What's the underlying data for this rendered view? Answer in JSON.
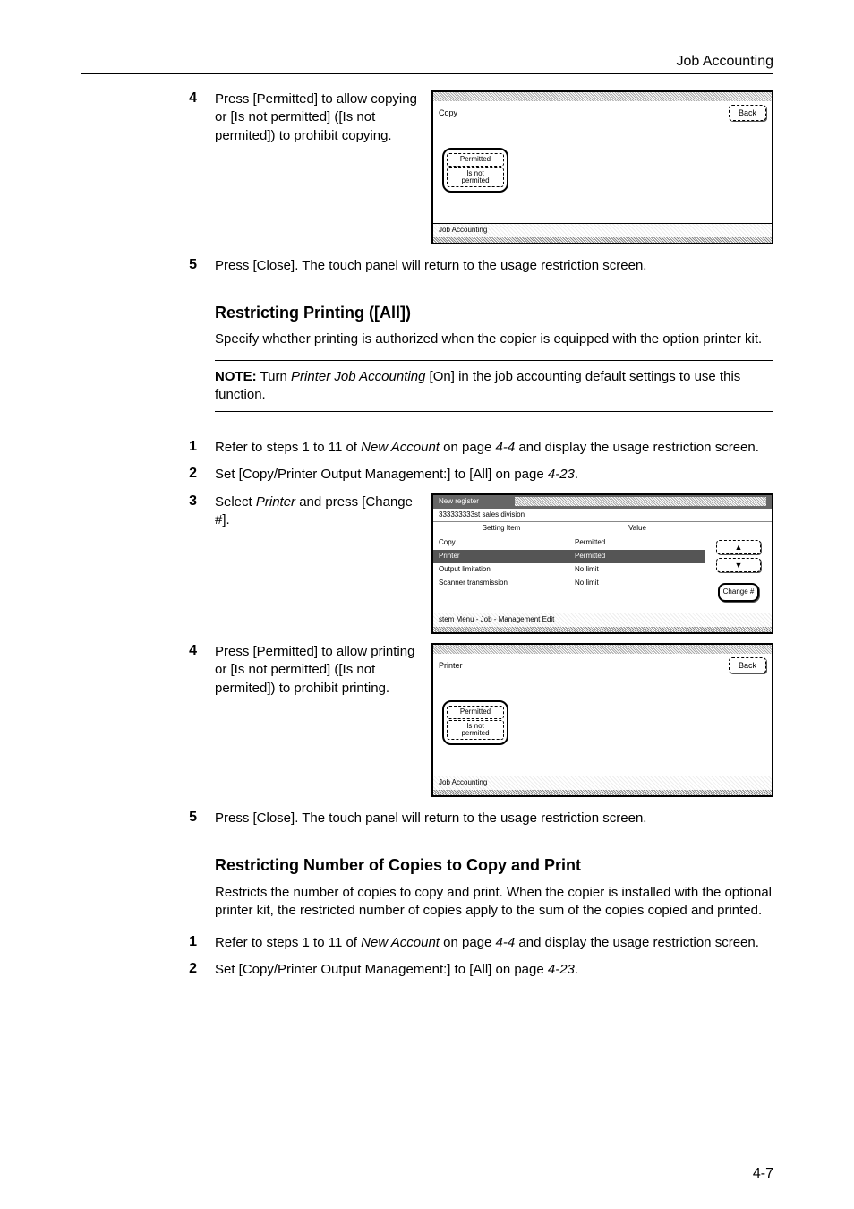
{
  "header": {
    "section": "Job Accounting"
  },
  "step4a": {
    "num": "4",
    "text": "Press [Permitted] to allow copying or [Is not permitted] ([Is not permited]) to prohibit copying."
  },
  "panelCopy": {
    "title": "Copy",
    "back": "Back",
    "opt1": "Permitted",
    "opt2a": "Is not",
    "opt2b": "permited",
    "footer": "Job Accounting"
  },
  "step5a": {
    "num": "5",
    "text": "Press [Close]. The touch panel will return to the usage restriction screen."
  },
  "sectionA": {
    "heading": "Restricting Printing ([All])",
    "intro": "Specify whether printing is authorized when the copier is equipped with the option printer kit.",
    "noteLabel": "NOTE:",
    "note1": " Turn ",
    "noteItalic": "Printer Job Accounting",
    "note2": " [On] in the job accounting default settings to use this function."
  },
  "step1b": {
    "num": "1",
    "pre": "Refer to steps 1 to 11 of ",
    "italic": "New Account",
    "mid": " on page ",
    "pageref": "4-4",
    "post": " and display the usage restriction screen."
  },
  "step2b": {
    "num": "2",
    "pre": "Set [Copy/Printer Output Management:] to [All] on page ",
    "pageref": "4-23",
    "post": "."
  },
  "step3b": {
    "num": "3",
    "pre": "Select ",
    "italic": "Printer",
    "post": " and press [Change #]."
  },
  "tablePanel": {
    "tab": "New register",
    "sub": "333333333st sales division",
    "colA": "Setting Item",
    "colB": "Value",
    "rows": [
      {
        "a": "Copy",
        "b": "Permitted"
      },
      {
        "a": "Printer",
        "b": "Permitted"
      },
      {
        "a": "Output limitation",
        "b": "No limit"
      },
      {
        "a": "Scanner transmission",
        "b": "No limit"
      }
    ],
    "change": "Change #",
    "footer": "stem Menu       -   Job               -   Management Edit"
  },
  "step4b": {
    "num": "4",
    "text": "Press [Permitted] to allow printing or [Is not permitted] ([Is not permited]) to prohibit printing."
  },
  "panelPrinter": {
    "title": "Printer",
    "back": "Back",
    "opt1": "Permitted",
    "opt2a": "Is not",
    "opt2b": "permited",
    "footer": "Job Accounting"
  },
  "step5b": {
    "num": "5",
    "text": "Press [Close]. The touch panel will return to the usage restriction screen."
  },
  "sectionB": {
    "heading": "Restricting Number of Copies to Copy and Print",
    "intro": "Restricts the number of copies to copy and print. When the copier is installed with the optional printer kit, the restricted number of copies apply to the sum of the copies copied and printed."
  },
  "step1c": {
    "num": "1",
    "pre": "Refer to steps 1 to 11 of ",
    "italic": "New Account",
    "mid": " on page ",
    "pageref": "4-4",
    "post": " and display the usage restriction screen."
  },
  "step2c": {
    "num": "2",
    "pre": "Set [Copy/Printer Output Management:] to [All] on page ",
    "pageref": "4-23",
    "post": "."
  },
  "pageNumber": "4-7"
}
